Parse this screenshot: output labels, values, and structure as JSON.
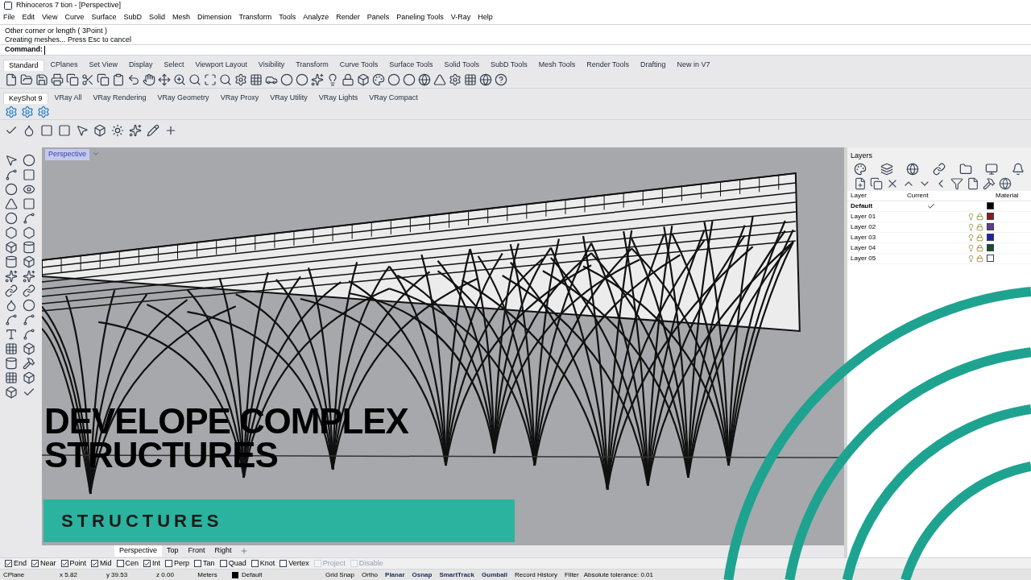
{
  "window": {
    "title": "Rhinoceros 7 tion - [Perspective]"
  },
  "menu": [
    "File",
    "Edit",
    "View",
    "Curve",
    "Surface",
    "SubD",
    "Solid",
    "Mesh",
    "Dimension",
    "Transform",
    "Tools",
    "Analyze",
    "Render",
    "Panels",
    "Paneling Tools",
    "V-Ray",
    "Help"
  ],
  "command_history": [
    "Other corner or length ( 3Point )",
    "Creating meshes... Press Esc to cancel"
  ],
  "command_prompt": "Command:",
  "toolbar_tabs": [
    {
      "label": "Standard",
      "selected": true
    },
    {
      "label": "CPlanes",
      "selected": false
    },
    {
      "label": "Set View",
      "selected": false
    },
    {
      "label": "Display",
      "selected": false
    },
    {
      "label": "Select",
      "selected": false
    },
    {
      "label": "Viewport Layout",
      "selected": false
    },
    {
      "label": "Visibility",
      "selected": false
    },
    {
      "label": "Transform",
      "selected": false
    },
    {
      "label": "Curve Tools",
      "selected": false
    },
    {
      "label": "Surface Tools",
      "selected": false
    },
    {
      "label": "Solid Tools",
      "selected": false
    },
    {
      "label": "SubD Tools",
      "selected": false
    },
    {
      "label": "Mesh Tools",
      "selected": false
    },
    {
      "label": "Render Tools",
      "selected": false
    },
    {
      "label": "Drafting",
      "selected": false
    },
    {
      "label": "New in V7",
      "selected": false
    }
  ],
  "plugin_tabs": [
    {
      "label": "KeyShot 9",
      "selected": true
    },
    {
      "label": "VRay All",
      "selected": false
    },
    {
      "label": "VRay Rendering",
      "selected": false
    },
    {
      "label": "VRay Geometry",
      "selected": false
    },
    {
      "label": "VRay Proxy",
      "selected": false
    },
    {
      "label": "VRay Utility",
      "selected": false
    },
    {
      "label": "VRay Lights",
      "selected": false
    },
    {
      "label": "VRay Compact",
      "selected": false
    }
  ],
  "viewport": {
    "label": "Perspective"
  },
  "overlay": {
    "title_lines": [
      "DEVELOPE COMPLEX",
      "STRUCTURES"
    ],
    "banner": "STRUCTURES"
  },
  "layers_panel": {
    "title": "Layers",
    "columns": [
      "Layer",
      "Current",
      "Material"
    ],
    "rows": [
      {
        "name": "Default",
        "current": true,
        "color": "#000000"
      },
      {
        "name": "Layer 01",
        "current": false,
        "color": "#8b1a1a"
      },
      {
        "name": "Layer 02",
        "current": false,
        "color": "#5b3f8c"
      },
      {
        "name": "Layer 03",
        "current": false,
        "color": "#1f1fa8"
      },
      {
        "name": "Layer 04",
        "current": false,
        "color": "#1f4d2a"
      },
      {
        "name": "Layer 05",
        "current": false,
        "color": "#ffffff"
      }
    ]
  },
  "viewport_tabs": [
    {
      "label": "Perspective",
      "selected": true
    },
    {
      "label": "Top",
      "selected": false
    },
    {
      "label": "Front",
      "selected": false
    },
    {
      "label": "Right",
      "selected": false
    }
  ],
  "osnaps": [
    {
      "label": "End",
      "checked": true,
      "disabled": false
    },
    {
      "label": "Near",
      "checked": true,
      "disabled": false
    },
    {
      "label": "Point",
      "checked": true,
      "disabled": false
    },
    {
      "label": "Mid",
      "checked": true,
      "disabled": false
    },
    {
      "label": "Cen",
      "checked": false,
      "disabled": false
    },
    {
      "label": "Int",
      "checked": true,
      "disabled": false
    },
    {
      "label": "Perp",
      "checked": false,
      "disabled": false
    },
    {
      "label": "Tan",
      "checked": false,
      "disabled": false
    },
    {
      "label": "Quad",
      "checked": false,
      "disabled": false
    },
    {
      "label": "Knot",
      "checked": false,
      "disabled": false
    },
    {
      "label": "Vertex",
      "checked": false,
      "disabled": false
    },
    {
      "label": "Project",
      "checked": false,
      "disabled": true
    },
    {
      "label": "Disable",
      "checked": false,
      "disabled": true
    }
  ],
  "status_bar": {
    "cplane": "CPlane",
    "x": "x 5.82",
    "y": "y 39.53",
    "z": "z 0.00",
    "units": "Meters",
    "layer": {
      "name": "Default",
      "color": "#000000"
    },
    "toggles": [
      {
        "label": "Grid Snap",
        "on": false
      },
      {
        "label": "Ortho",
        "on": false
      },
      {
        "label": "Planar",
        "on": true
      },
      {
        "label": "Osnap",
        "on": true
      },
      {
        "label": "SmartTrack",
        "on": true
      },
      {
        "label": "Gumball",
        "on": true
      },
      {
        "label": "Record History",
        "on": false
      },
      {
        "label": "Filter",
        "on": false
      }
    ],
    "tolerance": "Absolute tolerance: 0.01"
  }
}
